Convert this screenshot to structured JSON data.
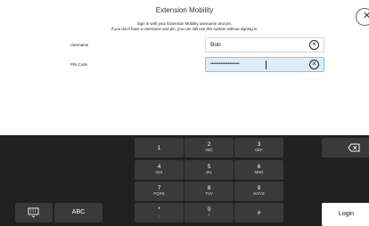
{
  "dialog": {
    "title": "Extension Mobility",
    "subtitle_line1": "Sign in with your Extension Mobility username and pin.",
    "subtitle_line2": "If you don't have a username and pin, you can still use this system without signing in.",
    "close_icon": "close-icon"
  },
  "form": {
    "username_label": "Username",
    "username_value": "Bob",
    "pin_label": "PIN Code",
    "pin_value": "••••••••••••••••••••",
    "clear_icon": "clear-icon"
  },
  "keypad": {
    "keys": [
      {
        "main": "1",
        "sub": ""
      },
      {
        "main": "2",
        "sub": "ABC"
      },
      {
        "main": "3",
        "sub": "DEF"
      },
      {
        "main": "4",
        "sub": "GHI"
      },
      {
        "main": "5",
        "sub": "JKL"
      },
      {
        "main": "6",
        "sub": "MNO"
      },
      {
        "main": "7",
        "sub": "PQRS"
      },
      {
        "main": "8",
        "sub": "TUV"
      },
      {
        "main": "9",
        "sub": "WXYZ"
      },
      {
        "main": "*",
        "sub": ","
      },
      {
        "main": "0",
        "sub": "+"
      },
      {
        "main": "#",
        "sub": ""
      }
    ],
    "abc_label": "ABC",
    "login_label": "Login",
    "keyboard_icon": "keyboard-icon",
    "backspace_icon": "backspace-icon"
  }
}
